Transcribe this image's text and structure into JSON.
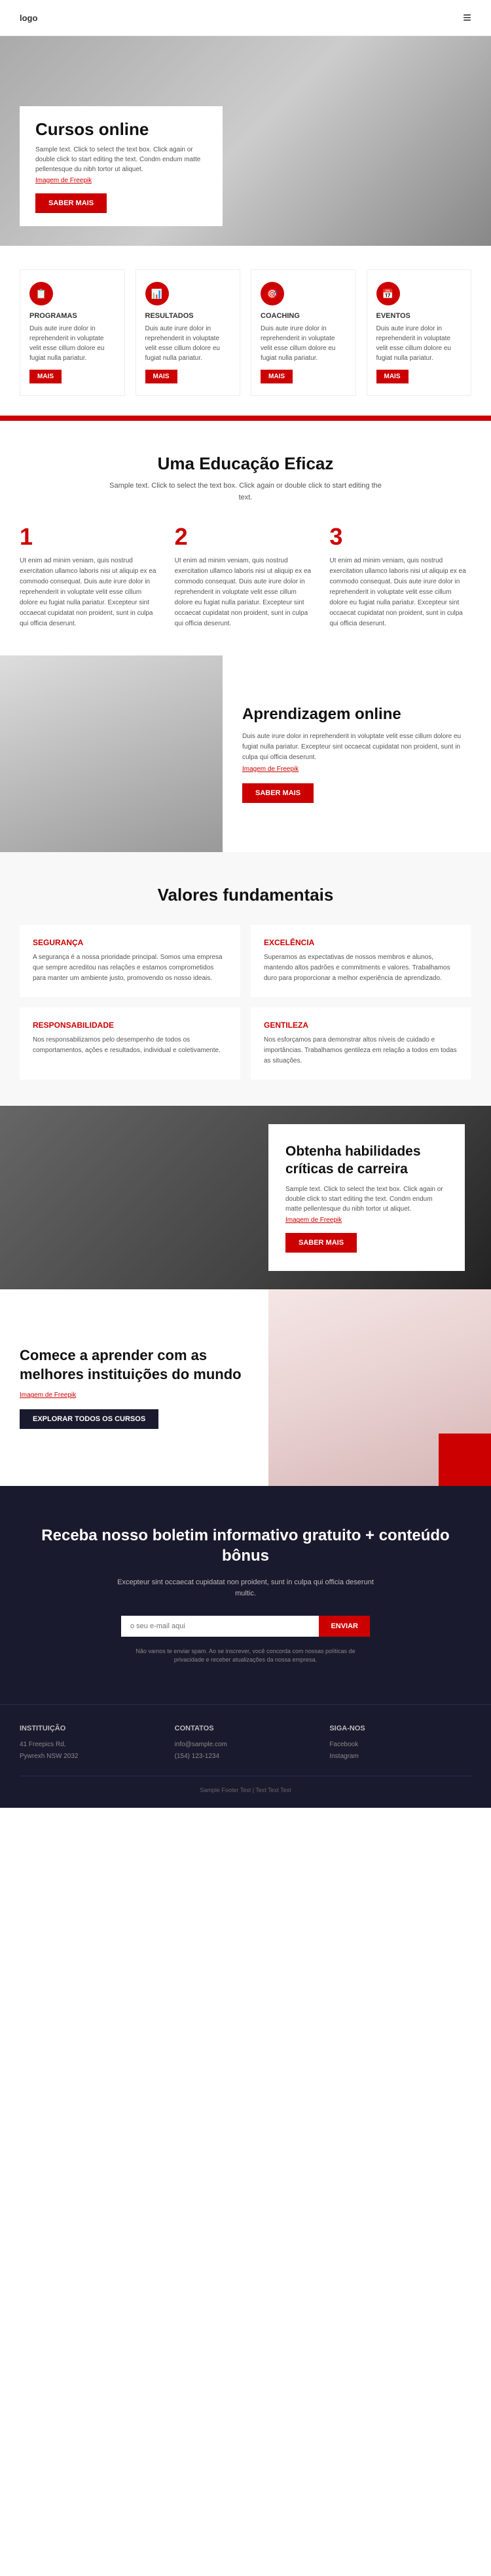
{
  "nav": {
    "logo": "logo",
    "menu_icon": "≡"
  },
  "hero": {
    "title": "Cursos online",
    "text": "Sample text. Click to select the text box. Click again or double click to start editing the text. Condm endum matte pellentesque du nibh tortor ut aliquet.",
    "image_credit": "Imagem de Freepik",
    "btn": "SABER MAIS"
  },
  "cards": [
    {
      "icon": "📋",
      "title": "PROGRAMAS",
      "text": "Duis aute irure dolor in reprehenderit in voluptate velit esse cillum dolore eu fugiat nulla pariatur.",
      "link": "MAIS"
    },
    {
      "icon": "📊",
      "title": "RESULTADOS",
      "text": "Duis aute irure dolor in reprehenderit in voluptate velit esse cillum dolore eu fugiat nulla pariatur.",
      "link": "MAIS"
    },
    {
      "icon": "🎯",
      "title": "COACHING",
      "text": "Duis aute irure dolor in reprehenderit in voluptate velit esse cillum dolore eu fugiat nulla pariatur.",
      "link": "MAIS"
    },
    {
      "icon": "📅",
      "title": "EVENTOS",
      "text": "Duis aute irure dolor in reprehenderit in voluptate velit esse cillum dolore eu fugiat nulla pariatur.",
      "link": "MAIS"
    }
  ],
  "education": {
    "title": "Uma Educação Eficaz",
    "subtitle": "Sample text. Click to select the text box. Click again or double click to start editing the text.",
    "items": [
      {
        "num": "1",
        "text": "Ut enim ad minim veniam, quis nostrud exercitation ullamco laboris nisi ut aliquip ex ea commodo consequat. Duis aute irure dolor in reprehenderit in voluptate velit esse cillum dolore eu fugiat nulla pariatur. Excepteur sint occaecat cupidatat non proident, sunt in culpa qui officia deserunt."
      },
      {
        "num": "2",
        "text": "Ut enim ad minim veniam, quis nostrud exercitation ullamco laboris nisi ut aliquip ex ea commodo consequat. Duis aute irure dolor in reprehenderit in voluptate velit esse cillum dolore eu fugiat nulla pariatur. Excepteur sint occaecat cupidatat non proident, sunt in culpa qui officia deserunt."
      },
      {
        "num": "3",
        "text": "Ut enim ad minim veniam, quis nostrud exercitation ullamco laboris nisi ut aliquip ex ea commodo consequat. Duis aute irure dolor in reprehenderit in voluptate velit esse cillum dolore eu fugiat nulla pariatur. Excepteur sint occaecat cupidatat non proident, sunt in culpa qui officia deserunt."
      }
    ]
  },
  "online": {
    "title": "Aprendizagem online",
    "text": "Duis aute irure dolor in reprehenderit in voluptate velit esse cillum dolore eu fugiat nulla pariatur. Excepteur sint occaecat cupidatat non proident, sunt in culpa qui officia deserunt.",
    "image_credit": "Imagem de Freepik",
    "btn": "SABER MAIS"
  },
  "values": {
    "title": "Valores fundamentais",
    "items": [
      {
        "title": "SEGURANÇA",
        "text": "A segurança é a nossa prioridade principal. Somos uma empresa que sempre acreditou nas relações e estamos comprometidos para manter um ambiente justo, promovendo os nosso ideais."
      },
      {
        "title": "EXCELÊNCIA",
        "text": "Superamos as expectativas de nossos membros e alunos, mantendo altos padrões e commitments e valores. Trabalhamos duro para proporcionar a melhor experiência de aprendizado."
      },
      {
        "title": "RESPONSABILIDADE",
        "text": "Nos responsabilizamos pelo desempenho de todos os comportamentos, ações e resultados, individual e coletivamente."
      },
      {
        "title": "GENTILEZA",
        "text": "Nos esforçamos para demonstrar altos níveis de cuidado e importâncias. Trabalhamos gentileza em relação a todos em todas as situações."
      }
    ]
  },
  "skills": {
    "title": "Obtenha habilidades críticas de carreira",
    "text": "Sample text. Click to select the text box. Click again or double click to start editing the text. Condm endum matte pellentesque du nibh tortor ut aliquet.",
    "image_credit": "Imagem de Freepik",
    "btn": "SABER MAIS"
  },
  "start": {
    "title": "Comece a aprender com as melhores instituições do mundo",
    "image_credit": "Imagem de Freepik",
    "btn": "EXPLORAR TODOS OS CURSOS"
  },
  "newsletter": {
    "title": "Receba nosso boletim informativo gratuito + conteúdo bônus",
    "text": "Excepteur sint occaecat cupidatat non proident, sunt in culpa qui officia deserunt multic.",
    "input_placeholder": "o seu e-mail aqui",
    "btn": "ENVIAR",
    "note": "Não vamos te enviar spam. Ao se inscrever, você concorda com nossas políticas de privacidade e receber atualizações da nossa empresa."
  },
  "footer": {
    "col1": {
      "title": "Instituição",
      "line1": "41 Freepics Rd,",
      "line2": "Pywrexh NSW 2032"
    },
    "col2": {
      "title": "Contatos",
      "email": "info@sample.com",
      "phone": "(154) 123-1234"
    },
    "col3": {
      "title": "Siga-nos",
      "link1": "Facebook",
      "link2": "Instagram"
    },
    "bottom": "Sample Footer Text | Text Text Text"
  }
}
